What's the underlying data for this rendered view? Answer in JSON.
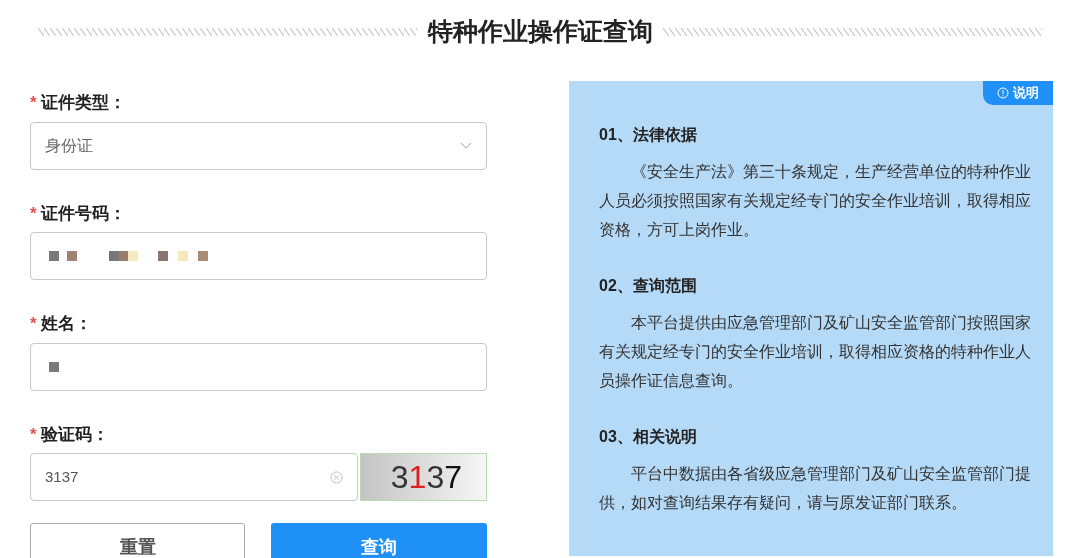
{
  "title": "特种作业操作证查询",
  "form": {
    "fields": [
      {
        "kind": "select",
        "marker": "*",
        "label": "证件类型：",
        "value": "身份证"
      },
      {
        "kind": "redacted",
        "marker": "*",
        "label": "证件号码："
      },
      {
        "kind": "redacted",
        "marker": "*",
        "label": "姓名："
      },
      {
        "kind": "captcha",
        "marker": "*",
        "label": "验证码：",
        "value": "3137",
        "captcha": [
          {
            "char": "3",
            "color": "#333333"
          },
          {
            "char": "1",
            "color": "#e02020"
          },
          {
            "char": "3",
            "color": "#333333"
          },
          {
            "char": "7",
            "color": "#111111"
          }
        ]
      }
    ],
    "buttons": [
      {
        "kind": "secondary",
        "label": "重置"
      },
      {
        "kind": "primary",
        "label": "查询"
      }
    ]
  },
  "info": {
    "badge": "说明",
    "sections": [
      {
        "heading": "01、法律依据",
        "text": "《安全生产法》第三十条规定，生产经营单位的特种作业人员必须按照国家有关规定经专门的安全作业培训，取得相应资格，方可上岗作业。"
      },
      {
        "heading": "02、查询范围",
        "text": "本平台提供由应急管理部门及矿山安全监管部门按照国家有关规定经专门的安全作业培训，取得相应资格的特种作业人员操作证信息查询。"
      },
      {
        "heading": "03、相关说明",
        "text": "平台中数据由各省级应急管理部门及矿山安全监管部门提供，如对查询结果存有疑问，请与原发证部门联系。"
      }
    ]
  }
}
